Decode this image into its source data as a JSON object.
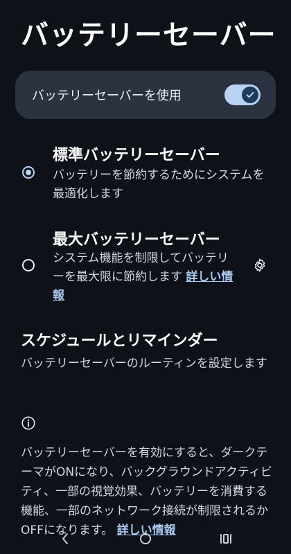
{
  "page": {
    "title": "バッテリーセーバー"
  },
  "master": {
    "label": "バッテリーセーバーを使用",
    "enabled": true
  },
  "options": [
    {
      "title": "標準バッテリーセーバー",
      "desc": "バッテリーを節約するためにシステムを最適化します",
      "selected": true
    },
    {
      "title": "最大バッテリーセーバー",
      "desc": "システム機能を制限してバッテリーを最大限に節約します",
      "link": "詳しい情報",
      "selected": false,
      "icon": "gear-icon"
    }
  ],
  "schedule": {
    "title": "スケジュールとリマインダー",
    "desc": "バッテリーセーバーのルーティンを設定します"
  },
  "footer": {
    "icon": "info-icon",
    "text": "バッテリーセーバーを有効にすると、ダークテーマがONになり、バックグラウンドアクティビティ、一部の視覚効果、バッテリーを消費する機能、一部のネットワーク接続が制限されるかOFFになります。",
    "link": "詳しい情報"
  },
  "colors": {
    "background": "#0e1218",
    "card": "#2b3340",
    "accent": "#b9d3f5",
    "link": "#a9c8f0"
  },
  "navbar": {
    "icons": [
      "back-icon",
      "home-icon",
      "recents-icon"
    ]
  }
}
